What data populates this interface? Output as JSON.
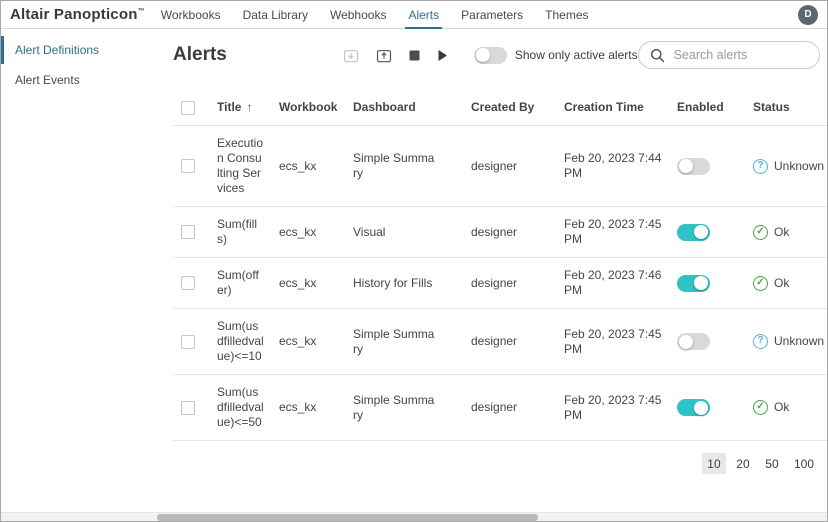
{
  "brand": {
    "name": "Altair Panopticon",
    "trademark": "™"
  },
  "nav": {
    "items": [
      {
        "label": "Workbooks"
      },
      {
        "label": "Data Library"
      },
      {
        "label": "Webhooks"
      },
      {
        "label": "Alerts"
      },
      {
        "label": "Parameters"
      },
      {
        "label": "Themes"
      }
    ],
    "active": "Alerts",
    "avatar_initial": "D"
  },
  "sidebar": {
    "items": [
      {
        "label": "Alert Definitions",
        "active": true
      },
      {
        "label": "Alert Events",
        "active": false
      }
    ]
  },
  "toolbar": {
    "title": "Alerts",
    "icons": [
      {
        "name": "import-alerts-icon",
        "disabled": true
      },
      {
        "name": "export-alerts-icon",
        "disabled": false
      },
      {
        "name": "stop-alerts-icon",
        "disabled": false
      },
      {
        "name": "start-alerts-icon",
        "disabled": false
      }
    ],
    "toggle": {
      "label": "Show only active alerts",
      "on": false
    },
    "search": {
      "placeholder": "Search alerts"
    }
  },
  "table": {
    "columns": [
      "Title",
      "Workbook",
      "Dashboard",
      "Created By",
      "Creation Time",
      "Enabled",
      "Status"
    ],
    "sort": {
      "column": "Title",
      "direction": "asc"
    },
    "rows": [
      {
        "title": "Execution Consulting Services",
        "workbook": "ecs_kx",
        "dashboard": "Simple Summary",
        "created_by": "designer",
        "creation_time": "Feb 20, 2023 7:44 PM",
        "enabled": false,
        "status": "Unknown"
      },
      {
        "title": "Sum(fills)",
        "workbook": "ecs_kx",
        "dashboard": "Visual",
        "created_by": "designer",
        "creation_time": "Feb 20, 2023 7:45 PM",
        "enabled": true,
        "status": "Ok"
      },
      {
        "title": "Sum(offer)",
        "workbook": "ecs_kx",
        "dashboard": "History for Fills",
        "created_by": "designer",
        "creation_time": "Feb 20, 2023 7:46 PM",
        "enabled": true,
        "status": "Ok"
      },
      {
        "title": "Sum(usdfilledvalue)<=10",
        "workbook": "ecs_kx",
        "dashboard": "Simple Summary",
        "created_by": "designer",
        "creation_time": "Feb 20, 2023 7:45 PM",
        "enabled": false,
        "status": "Unknown"
      },
      {
        "title": "Sum(usdfilledvalue)<=50",
        "workbook": "ecs_kx",
        "dashboard": "Simple Summary",
        "created_by": "designer",
        "creation_time": "Feb 20, 2023 7:45 PM",
        "enabled": true,
        "status": "Ok"
      }
    ]
  },
  "pagination": {
    "page_sizes": [
      "10",
      "20",
      "50",
      "100"
    ],
    "selected": "10"
  },
  "colors": {
    "accent_teal": "#2fc2c6",
    "active_blue": "#2d7191",
    "status_ok_green": "#4aa34a",
    "status_unknown_blue": "#53b5dc"
  }
}
